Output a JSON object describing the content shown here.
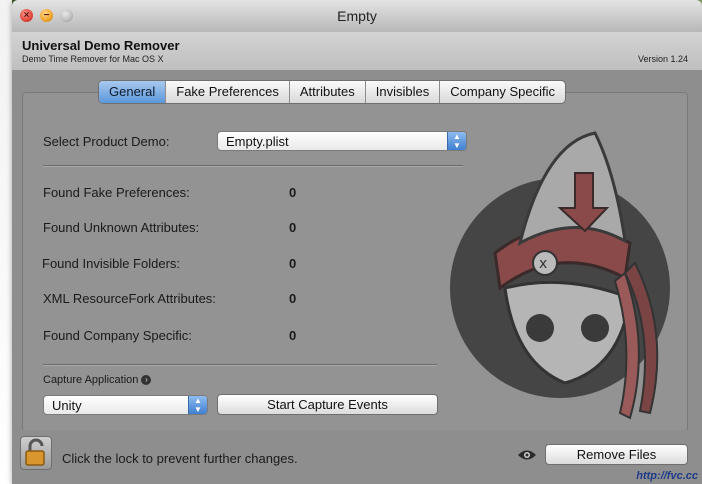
{
  "window": {
    "title": "Empty"
  },
  "app": {
    "name": "Universal Demo Remover",
    "subtitle": "Demo Time Remover for Mac OS X",
    "version": "Version 1.24"
  },
  "tabs": [
    {
      "label": "General",
      "active": true
    },
    {
      "label": "Fake Preferences",
      "active": false
    },
    {
      "label": "Attributes",
      "active": false
    },
    {
      "label": "Invisibles",
      "active": false
    },
    {
      "label": "Company Specific",
      "active": false
    }
  ],
  "general": {
    "select_label": "Select Product Demo:",
    "select_value": "Empty.plist",
    "rows": [
      {
        "label": "Found Fake Preferences:",
        "value": "0"
      },
      {
        "label": "Found Unknown Attributes:",
        "value": "0"
      },
      {
        "label": "Found Invisible Folders:",
        "value": "0"
      },
      {
        "label": "XML ResourceFork Attributes:",
        "value": "0"
      },
      {
        "label": "Found Company Specific:",
        "value": "0"
      }
    ],
    "capture_label": "Capture Application",
    "capture_select_value": "Unity",
    "capture_button": "Start Capture Events"
  },
  "footer": {
    "lock_text": "Click the lock to prevent further changes.",
    "remove_button": "Remove Files"
  },
  "watermark": "http://fvc.cc",
  "colors": {
    "accent": "#5b97db",
    "window_bg": "#8f8f8f"
  }
}
